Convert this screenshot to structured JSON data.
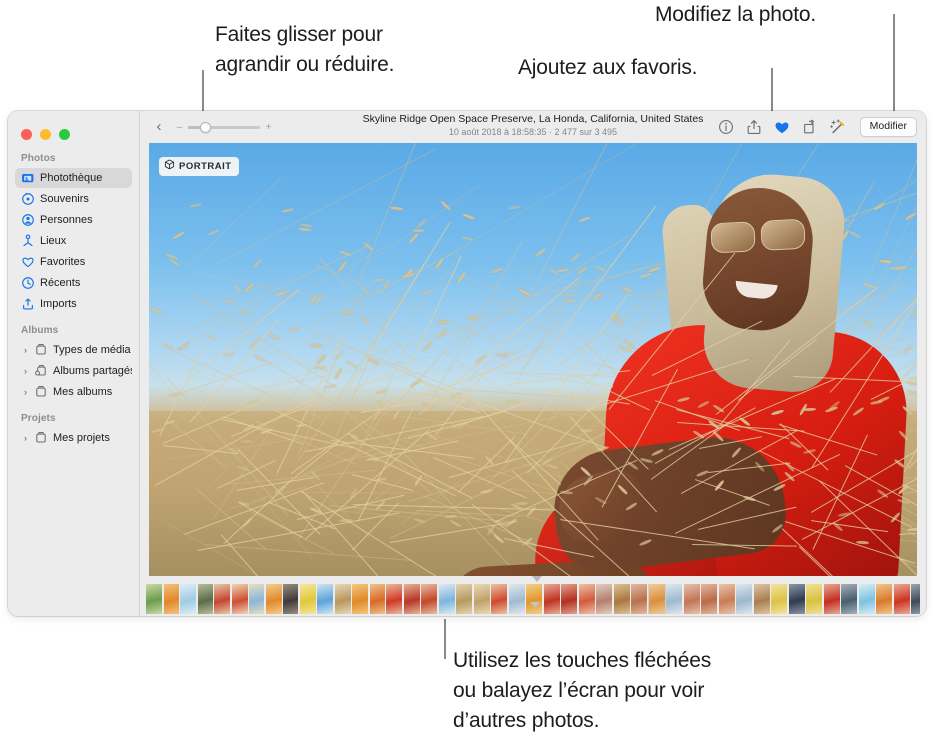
{
  "callouts": [
    {
      "id": "zoom-slider",
      "text": "Faites glisser pour\nagrandir ou réduire."
    },
    {
      "id": "favorite",
      "text": "Ajoutez aux favoris."
    },
    {
      "id": "edit",
      "text": "Modifiez la photo."
    },
    {
      "id": "filmstrip",
      "text": "Utilisez les touches fléchées\nou balayez l’écran pour voir\nd’autres photos."
    }
  ],
  "window": {
    "traffic_lights": [
      "close",
      "minimize",
      "zoom"
    ],
    "sidebar": {
      "groups": [
        {
          "title": "Photos",
          "items": [
            {
              "label": "Photothèque",
              "icon": "photo-library-icon",
              "selected": true,
              "disclosure": false
            },
            {
              "label": "Souvenirs",
              "icon": "memories-icon",
              "selected": false,
              "disclosure": false
            },
            {
              "label": "Personnes",
              "icon": "people-icon",
              "selected": false,
              "disclosure": false
            },
            {
              "label": "Lieux",
              "icon": "places-icon",
              "selected": false,
              "disclosure": false
            },
            {
              "label": "Favorites",
              "icon": "heart-icon",
              "selected": false,
              "disclosure": false
            },
            {
              "label": "Récents",
              "icon": "clock-icon",
              "selected": false,
              "disclosure": false
            },
            {
              "label": "Imports",
              "icon": "import-icon",
              "selected": false,
              "disclosure": false
            }
          ]
        },
        {
          "title": "Albums",
          "items": [
            {
              "label": "Types de média",
              "icon": "album-icon",
              "selected": false,
              "disclosure": true
            },
            {
              "label": "Albums partagés",
              "icon": "shared-album-icon",
              "selected": false,
              "disclosure": true
            },
            {
              "label": "Mes albums",
              "icon": "album-icon",
              "selected": false,
              "disclosure": true
            }
          ]
        },
        {
          "title": "Projets",
          "items": [
            {
              "label": "Mes projets",
              "icon": "album-icon",
              "selected": false,
              "disclosure": true
            }
          ]
        }
      ]
    },
    "toolbar": {
      "back_icon": "chevron-left-icon",
      "zoom": {
        "minus_label": "–",
        "plus_label": "+",
        "value_percent": 17
      },
      "title": "Skyline Ridge Open Space Preserve, La Honda, California, United States",
      "subtitle": "10 août 2018 à 18:58:35  ·  2 477 sur 3 495",
      "actions": [
        {
          "icon": "info-icon",
          "name": "info-button"
        },
        {
          "icon": "share-icon",
          "name": "share-button"
        },
        {
          "icon": "heart-filled-icon",
          "name": "favorite-button",
          "active": true
        },
        {
          "icon": "rotate-icon",
          "name": "rotate-button"
        },
        {
          "icon": "enhance-icon",
          "name": "auto-enhance-button"
        }
      ],
      "edit_label": "Modifier",
      "accent_color": "#1675e8"
    },
    "photo": {
      "badge_label": "PORTRAIT",
      "badge_icon": "depth-cube-icon"
    },
    "filmstrip": {
      "thumbnails": [
        {
          "w": 16,
          "c1": "#6d9c4e",
          "c2": "#c9d9a8"
        },
        {
          "w": 15,
          "c1": "#e2872a",
          "c2": "#f2c37a"
        },
        {
          "w": 16,
          "c1": "#9fcbe6",
          "c2": "#dfeef6"
        },
        {
          "w": 15,
          "c1": "#5b6b4a",
          "c2": "#b6bd9b"
        },
        {
          "w": 16,
          "c1": "#c64632",
          "c2": "#e7c8a8"
        },
        {
          "w": 16,
          "c1": "#cf4e35",
          "c2": "#efd6b4"
        },
        {
          "w": 15,
          "c1": "#8bb6d8",
          "c2": "#e6dfc3"
        },
        {
          "w": 16,
          "c1": "#e0892c",
          "c2": "#f5cd8c"
        },
        {
          "w": 15,
          "c1": "#3f3b3a",
          "c2": "#9c8d7e"
        },
        {
          "w": 16,
          "c1": "#dfc83c",
          "c2": "#f4e79c"
        },
        {
          "w": 16,
          "c1": "#5ba3d8",
          "c2": "#cfe6f4"
        },
        {
          "w": 16,
          "c1": "#b9975f",
          "c2": "#e7d9b3"
        },
        {
          "w": 16,
          "c1": "#e08a2a",
          "c2": "#f3c87f"
        },
        {
          "w": 15,
          "c1": "#d86a26",
          "c2": "#eec38a"
        },
        {
          "w": 16,
          "c1": "#cf3a25",
          "c2": "#eab89d"
        },
        {
          "w": 16,
          "c1": "#b83726",
          "c2": "#e5b39a"
        },
        {
          "w": 16,
          "c1": "#c4472c",
          "c2": "#e8bda1"
        },
        {
          "w": 16,
          "c1": "#7db5dd",
          "c2": "#ddeaf3"
        },
        {
          "w": 16,
          "c1": "#b69a63",
          "c2": "#e4d5ae"
        },
        {
          "w": 16,
          "c1": "#c2a06b",
          "c2": "#e8d9b4"
        },
        {
          "w": 16,
          "c1": "#cf4a2f",
          "c2": "#e9c3a3"
        },
        {
          "w": 16,
          "c1": "#9fbbd1",
          "c2": "#e2e8ee"
        },
        {
          "w": 16,
          "c1": "#e0962c",
          "c2": "#f4d08b"
        },
        {
          "w": 16,
          "c1": "#c03325",
          "c2": "#e6ab95"
        },
        {
          "w": 16,
          "c1": "#b52f22",
          "c2": "#e0a48d"
        },
        {
          "w": 16,
          "c1": "#d55a3d",
          "c2": "#ecc0a6"
        },
        {
          "w": 16,
          "c1": "#b4806d",
          "c2": "#e3cdc0"
        },
        {
          "w": 16,
          "c1": "#a8783f",
          "c2": "#ddc295"
        },
        {
          "w": 16,
          "c1": "#b7704c",
          "c2": "#e2bba0"
        },
        {
          "w": 16,
          "c1": "#d98f3f",
          "c2": "#efcd97",
          "selected": true
        },
        {
          "w": 16,
          "c1": "#9eb9cd",
          "c2": "#dfe8ef"
        },
        {
          "w": 16,
          "c1": "#c47556",
          "c2": "#e6c0ac"
        },
        {
          "w": 16,
          "c1": "#ba6a48",
          "c2": "#e1b89f"
        },
        {
          "w": 16,
          "c1": "#c97c55",
          "c2": "#e8c4ac"
        },
        {
          "w": 16,
          "c1": "#9cb7cb",
          "c2": "#dee7ee"
        },
        {
          "w": 16,
          "c1": "#a97f52",
          "c2": "#dcc6a3"
        },
        {
          "w": 16,
          "c1": "#ddc246",
          "c2": "#f2e59f"
        },
        {
          "w": 16,
          "c1": "#2f3b4e",
          "c2": "#8c98a8"
        },
        {
          "w": 16,
          "c1": "#d8c13f",
          "c2": "#f0e29a"
        },
        {
          "w": 16,
          "c1": "#c42f22",
          "c2": "#e7a993"
        },
        {
          "w": 16,
          "c1": "#4a5e6e",
          "c2": "#a3b2bd"
        },
        {
          "w": 16,
          "c1": "#7ec2e0",
          "c2": "#d6eef6"
        },
        {
          "w": 16,
          "c1": "#d97a2c",
          "c2": "#efc78b"
        },
        {
          "w": 16,
          "c1": "#cd3322",
          "c2": "#eaab94"
        },
        {
          "w": 16,
          "c1": "#3f4a58",
          "c2": "#9aa5b1"
        },
        {
          "w": 16,
          "c1": "#c8372b",
          "c2": "#e9ae98"
        },
        {
          "w": 16,
          "c1": "#d2483a",
          "c2": "#ecb9a6"
        },
        {
          "w": 16,
          "c1": "#6eaedb",
          "c2": "#d3e8f6"
        },
        {
          "w": 16,
          "c1": "#8fb9d4",
          "c2": "#dbe9f2"
        },
        {
          "w": 16,
          "c1": "#3c78b5",
          "c2": "#a7c6e2"
        },
        {
          "w": 16,
          "c1": "#4e86c0",
          "c2": "#b0cfe7"
        },
        {
          "w": 16,
          "c1": "#3b5d86",
          "c2": "#9db6d1"
        },
        {
          "w": 16,
          "c1": "#6a4a38",
          "c2": "#bda294"
        },
        {
          "w": 16,
          "c1": "#cb3b2b",
          "c2": "#e9b19c"
        },
        {
          "w": 16,
          "c1": "#a06a4c",
          "c2": "#d5b9a5"
        },
        {
          "w": 16,
          "c1": "#c9bda8",
          "c2": "#efe8dc"
        },
        {
          "w": 16,
          "c1": "#d7d2c4",
          "c2": "#f4f1ea"
        },
        {
          "w": 16,
          "c1": "#b5a58e",
          "c2": "#e2dacd"
        },
        {
          "w": 16,
          "c1": "#e3c56a",
          "c2": "#f5e6b6"
        },
        {
          "w": 16,
          "c1": "#2f86c6",
          "c2": "#a3cde8"
        }
      ]
    }
  }
}
